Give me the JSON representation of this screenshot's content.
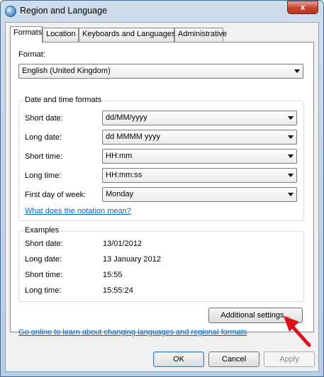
{
  "window": {
    "title": "Region and Language",
    "close_glyph": "x"
  },
  "tabs": [
    {
      "label": "Formats",
      "active": true
    },
    {
      "label": "Location",
      "active": false
    },
    {
      "label": "Keyboards and Languages",
      "active": false
    },
    {
      "label": "Administrative",
      "active": false
    }
  ],
  "format": {
    "label": "Format:",
    "value": "English (United Kingdom)"
  },
  "date_time_formats": {
    "title": "Date and time formats",
    "rows": [
      {
        "label": "Short date:",
        "value": "dd/MM/yyyy"
      },
      {
        "label": "Long date:",
        "value": "dd MMMM yyyy"
      },
      {
        "label": "Short time:",
        "value": "HH:mm"
      },
      {
        "label": "Long time:",
        "value": "HH:mm:ss"
      },
      {
        "label": "First day of week:",
        "value": "Monday"
      }
    ],
    "notation_link": "What does the notation mean?"
  },
  "examples": {
    "title": "Examples",
    "rows": [
      {
        "label": "Short date:",
        "value": "13/01/2012"
      },
      {
        "label": "Long date:",
        "value": "13 January 2012"
      },
      {
        "label": "Short time:",
        "value": "15:55"
      },
      {
        "label": "Long time:",
        "value": "15:55:24"
      }
    ]
  },
  "additional_settings_label": "Additional settings...",
  "online_link": "Go online to learn about changing languages and regional formats",
  "buttons": {
    "ok": "OK",
    "cancel": "Cancel",
    "apply": "Apply"
  },
  "colors": {
    "link": "#0066cc",
    "annotation_arrow": "#e0101a",
    "close_button": "#c7402d"
  }
}
